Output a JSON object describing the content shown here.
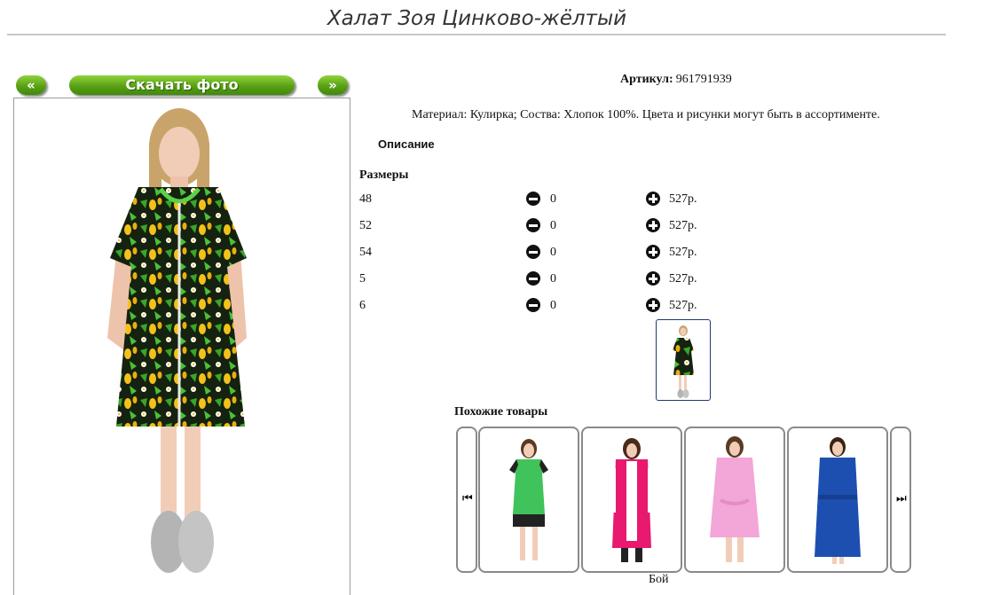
{
  "page": {
    "title": "Халат Зоя Цинково-жёлтый"
  },
  "photo_nav": {
    "prev_label": "«",
    "download_label": "Скачать фото",
    "next_label": "»"
  },
  "product": {
    "article_label": "Артикул:",
    "article_value": "961791939",
    "material_text": "Материал: Кулирка; Соства: Хлопок 100%. Цвета и рисунки могут быть в ассортименте.",
    "description_label": "Описание",
    "sizes_label": "Размеры",
    "sizes": [
      {
        "size": "48",
        "qty": "0",
        "price": "527р."
      },
      {
        "size": "52",
        "qty": "0",
        "price": "527р."
      },
      {
        "size": "54",
        "qty": "0",
        "price": "527р."
      },
      {
        "size": "5",
        "qty": "0",
        "price": "527р."
      },
      {
        "size": "6",
        "qty": "0",
        "price": "527р."
      }
    ]
  },
  "similar": {
    "label": "Похожие товары",
    "prev_icon": "skip-previous-icon",
    "next_icon": "skip-next-icon",
    "items": [
      {
        "color": "#3fc35a"
      },
      {
        "color": "#e8196e"
      },
      {
        "color": "#f3a6d8"
      },
      {
        "color": "#1d4fb0"
      }
    ]
  },
  "footer": {
    "partial_text": "Бой"
  },
  "colors": {
    "button_green": "#5aa016",
    "border_gray": "#8a8a8a",
    "thumb_border": "#1e3a6e"
  }
}
